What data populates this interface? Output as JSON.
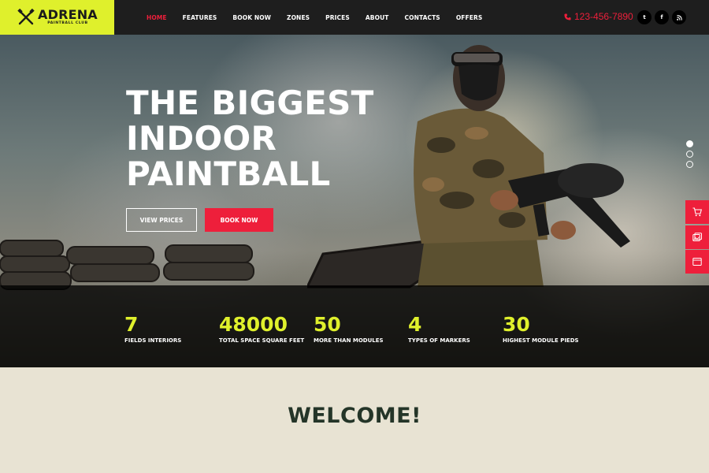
{
  "brand": {
    "name": "ADRENA",
    "tagline": "PAINTBALL CLUB",
    "accent": "#dff02c",
    "red": "#ee1f3b"
  },
  "nav": {
    "items": [
      {
        "label": "HOME",
        "active": true
      },
      {
        "label": "FEATURES"
      },
      {
        "label": "BOOK NOW"
      },
      {
        "label": "ZONES"
      },
      {
        "label": "PRICES"
      },
      {
        "label": "ABOUT"
      },
      {
        "label": "CONTACTS"
      },
      {
        "label": "OFFERS"
      }
    ]
  },
  "contact": {
    "phone": "123-456-7890",
    "phone_icon": "phone-icon"
  },
  "social": [
    {
      "name": "twitter-icon",
      "glyph": "t"
    },
    {
      "name": "facebook-icon",
      "glyph": "f"
    },
    {
      "name": "rss-icon",
      "glyph": "r"
    }
  ],
  "hero": {
    "headline": [
      "THE BIGGEST",
      "INDOOR",
      "PAINTBALL"
    ],
    "btn_prices": "VIEW PRICES",
    "btn_book": "BOOK NOW",
    "slides": 3,
    "active_slide": 1
  },
  "side_tools": [
    "cart-icon",
    "gallery-icon",
    "browser-icon"
  ],
  "stats": [
    {
      "value": "7",
      "label": "FIELDS INTERIORS"
    },
    {
      "value": "48000",
      "label": "TOTAL SPACE SQUARE FEET"
    },
    {
      "value": "50",
      "label": "MORE THAN MODULES"
    },
    {
      "value": "4",
      "label": "TYPES OF MARKERS"
    },
    {
      "value": "30",
      "label": "HIGHEST MODULE PIEDS"
    }
  ],
  "welcome": {
    "title": "WELCOME!"
  }
}
